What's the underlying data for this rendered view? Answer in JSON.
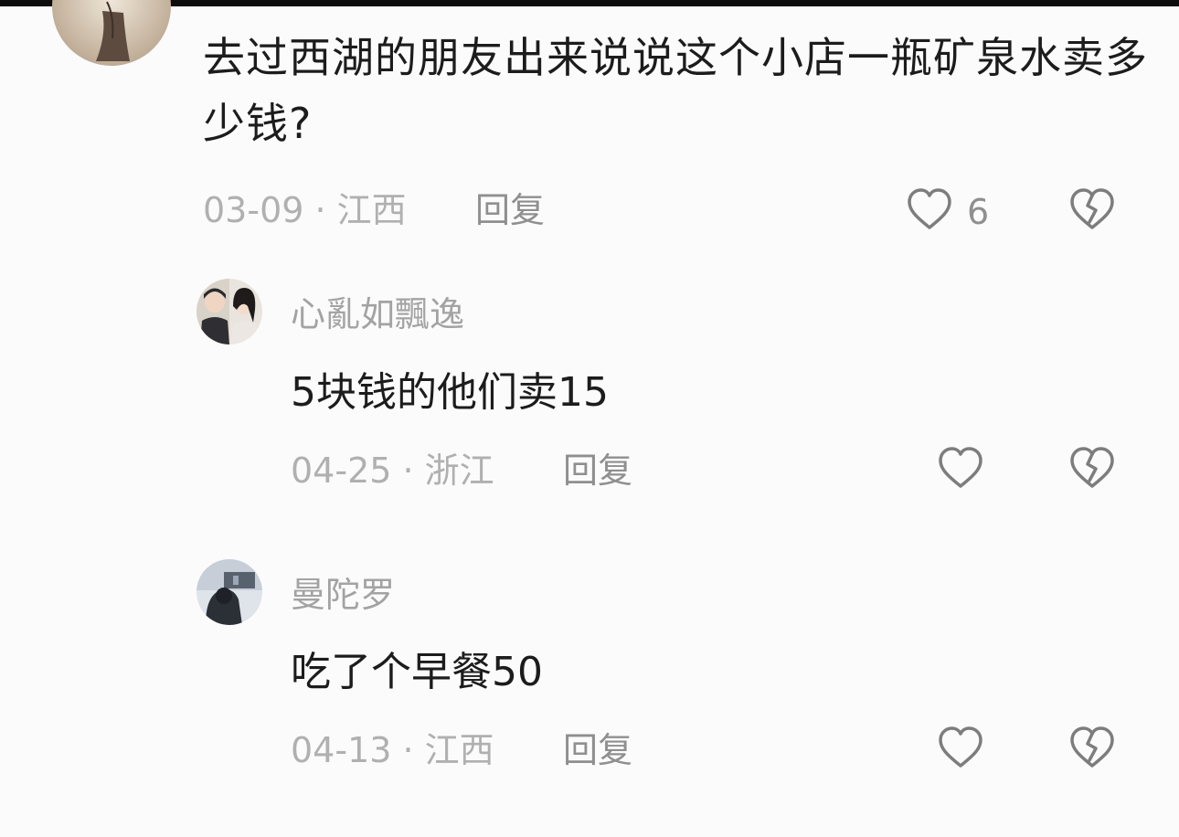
{
  "comments": [
    {
      "text": "去过西湖的朋友出来说说这个小店一瓶矿泉水卖多少钱?",
      "meta": "03-09 · 江西",
      "reply_label": "回复",
      "likes": "6"
    }
  ],
  "replies": [
    {
      "username": "心亂如飄逸",
      "text": "5块钱的他们卖15",
      "meta": "04-25 · 浙江",
      "reply_label": "回复"
    },
    {
      "username": "曼陀罗",
      "text": "吃了个早餐50",
      "meta": "04-13 · 江西",
      "reply_label": "回复"
    }
  ],
  "icons": {
    "like": "heart-outline-icon",
    "dislike": "broken-heart-icon"
  },
  "colors": {
    "text": "#1c1c1c",
    "secondary": "#b0b0b0",
    "icon": "#7d7d7d",
    "background": "#fbfbfb"
  }
}
